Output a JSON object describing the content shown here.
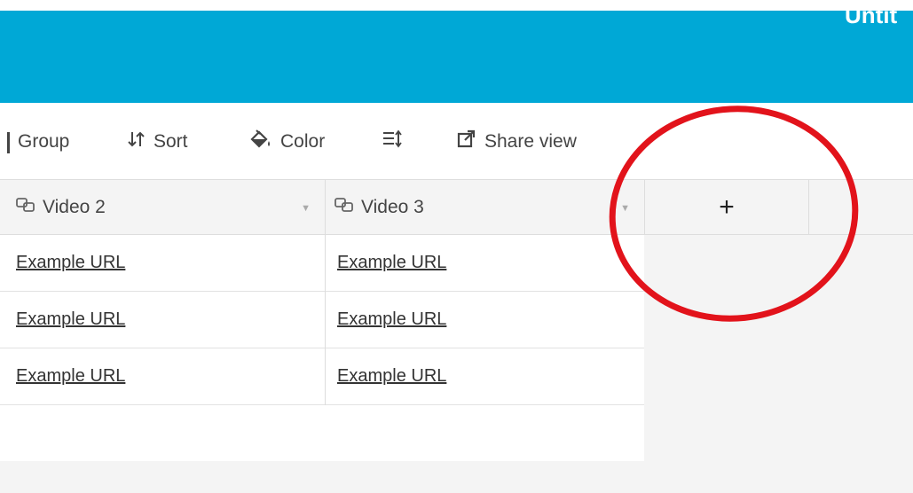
{
  "header": {
    "title": "Untit"
  },
  "toolbar": {
    "group_label": "Group",
    "sort_label": "Sort",
    "color_label": "Color",
    "share_label": "Share view"
  },
  "columns": [
    {
      "label": "Video 2"
    },
    {
      "label": "Video 3"
    }
  ],
  "add_column_label": "+",
  "rows": [
    [
      "Example URL",
      "Example URL"
    ],
    [
      "Example URL",
      "Example URL"
    ],
    [
      "Example URL",
      "Example URL"
    ]
  ],
  "colors": {
    "header": "#00a8d6",
    "annotation": "#e2131b"
  }
}
